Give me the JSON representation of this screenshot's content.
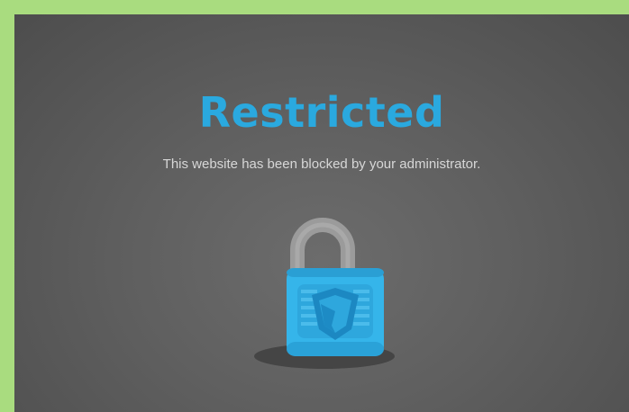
{
  "page": {
    "title": "Restricted",
    "message": "This website has been blocked by your administrator."
  },
  "icons": {
    "lock": "padlock-shield-icon"
  },
  "colors": {
    "outer_border": "#a9dc7f",
    "title": "#2aa9df",
    "lock_body": "#35b5ea",
    "lock_shackle": "#9a9a9a",
    "message": "#d7d7d7"
  }
}
